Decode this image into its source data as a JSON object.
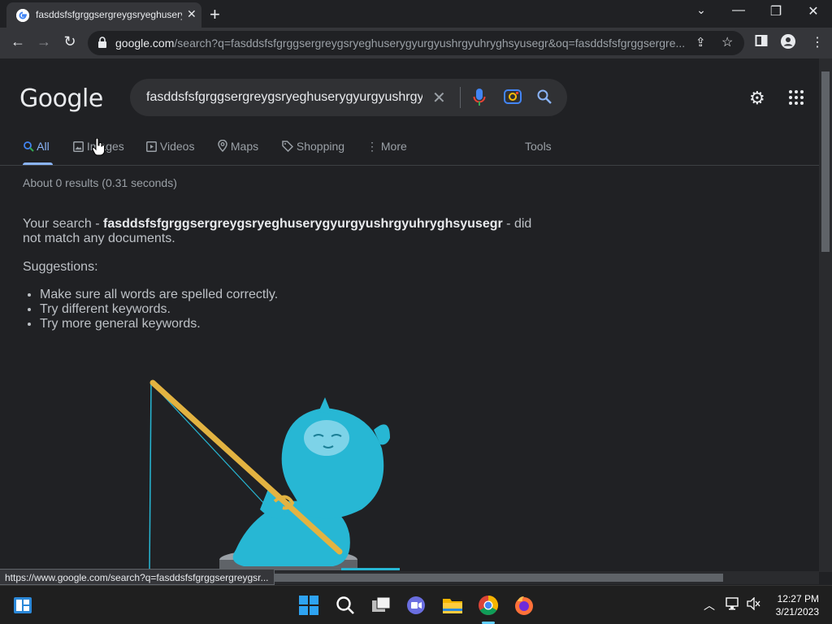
{
  "browser": {
    "tab_title": "fasddsfsfgrggsergreygsryeghuserygyurgyushrgyuhryghsyusegr - Google Search",
    "new_tab": "+",
    "tab_close": "✕",
    "window_minimize": "—",
    "window_restore": "❐",
    "window_close": "✕",
    "url_host": "google.com",
    "url_path": "/search?q=fasddsfsfgrggsergreygsryeghuserygyurgyushrgyuhryghsyusegr&oq=fasddsfsfgrggsergre..."
  },
  "google": {
    "logo": "Google",
    "search_value": "fasddsfsfgrggsergreygsryeghuserygyurgyushrgyuhryghsyusegr",
    "tabs": [
      {
        "label": "All"
      },
      {
        "label": "Images"
      },
      {
        "label": "Videos"
      },
      {
        "label": "Maps"
      },
      {
        "label": "Shopping"
      },
      {
        "label": "More"
      }
    ],
    "tools": "Tools",
    "stats": "About 0 results (0.31 seconds)",
    "no_match_prefix": "Your search - ",
    "no_match_query": "fasddsfsfgrggsergreygsryeghuserygyurgyushrgyuhryghsyusegr",
    "no_match_suffix": " - did not match any documents.",
    "suggestions_title": "Suggestions:",
    "suggestions": [
      "Make sure all words are spelled correctly.",
      "Try different keywords.",
      "Try more general keywords."
    ]
  },
  "status_url": "https://www.google.com/search?q=fasddsfsfgrggsergreygsr...",
  "taskbar": {
    "time": "12:27 PM",
    "date": "3/21/2023"
  },
  "colors": {
    "background": "#202124",
    "accent": "#8ab4f8",
    "mascot": "#27b7d4",
    "rod": "#e3b341"
  }
}
